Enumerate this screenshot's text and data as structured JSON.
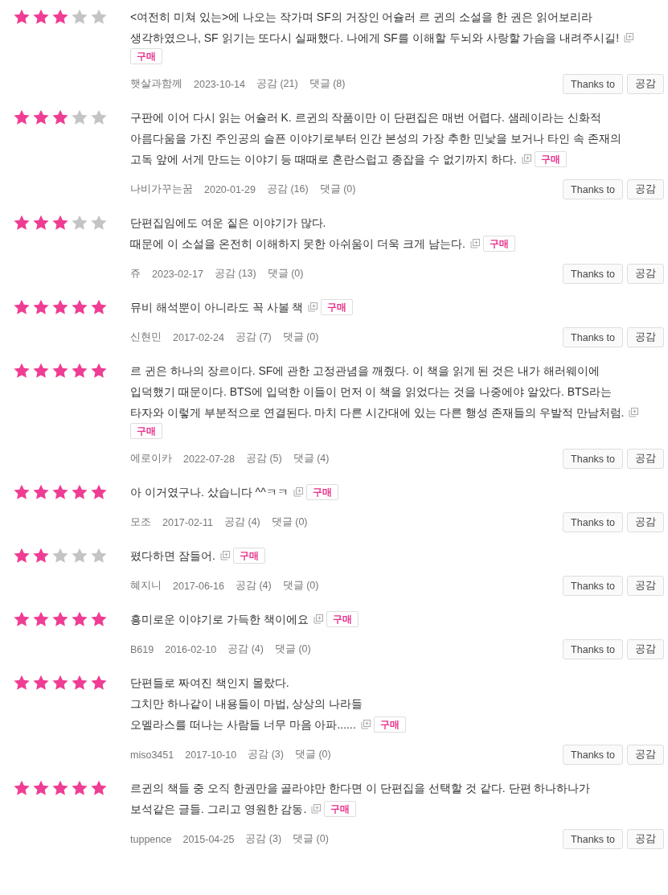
{
  "reviews": [
    {
      "stars": 3,
      "text": "<여전히 미쳐 있는>에 나오는 작가며 SF의 거장인 어슐러 르 귄의 소설을 한 권은 읽어보리라\n생각하였으나, SF 읽기는 또다시 실패했다. 나에게 SF를 이해할 두뇌와 사랑할 가슴을 내려주시길!",
      "badge": "구매",
      "author": "햇살과함께",
      "date": "2023-10-14",
      "likes": "공감 (21)",
      "comments": "댓글 (8)",
      "buttons": [
        "Thanks to",
        "공감"
      ]
    },
    {
      "stars": 3,
      "text": "구판에 이어 다시 읽는 어슐러 K. 르귄의 작품이만 이 단편집은 매번 어렵다. 샘레이라는 신화적\n아름다움을 가진 주인공의 슬픈 이야기로부터 인간 본성의 가장 추한 민낯을 보거나 타인 속 존재의\n고독 앞에 서게 만드는 이야기 등 때때로 혼란스럽고 종잡을 수 없기까지 하다.",
      "badge": "구매",
      "author": "나비가꾸는꿈",
      "date": "2020-01-29",
      "likes": "공감 (16)",
      "comments": "댓글 (0)",
      "buttons": [
        "Thanks to",
        "공감"
      ]
    },
    {
      "stars": 3,
      "text": "단편집임에도 여운 짙은 이야기가 많다.\n때문에 이 소설을 온전히 이해하지 못한 아쉬움이 더욱 크게 남는다.",
      "badge": "구매",
      "author": "쥬",
      "date": "2023-02-17",
      "likes": "공감 (13)",
      "comments": "댓글 (0)",
      "buttons": [
        "Thanks to",
        "공감"
      ]
    },
    {
      "stars": 5,
      "text": "뮤비 해석뿐이 아니라도 꼭 사볼 책",
      "badge": "구매",
      "author": "신현민",
      "date": "2017-02-24",
      "likes": "공감 (7)",
      "comments": "댓글 (0)",
      "buttons": [
        "Thanks to",
        "공감"
      ]
    },
    {
      "stars": 5,
      "text": "르 귄은 하나의 장르이다. SF에 관한 고정관념을 깨줬다. 이 책을 읽게 된 것은 내가 해러웨이에\n입덕했기 때문이다. BTS에 입덕한 이들이 먼저 이 책을 읽었다는 것을 나중에야 알았다. BTS라는\n타자와 이렇게 부분적으로 연결된다. 마치 다른 시간대에 있는 다른 행성 존재들의 우발적 만남처럼.",
      "badge": "구매",
      "author": "에로이카",
      "date": "2022-07-28",
      "likes": "공감 (5)",
      "comments": "댓글 (4)",
      "buttons": [
        "Thanks to",
        "공감"
      ]
    },
    {
      "stars": 5,
      "text": "아 이거였구나. 샀습니다 ^^ㅋㅋ",
      "badge": "구매",
      "author": "모조",
      "date": "2017-02-11",
      "likes": "공감 (4)",
      "comments": "댓글 (0)",
      "buttons": [
        "Thanks to",
        "공감"
      ]
    },
    {
      "stars": 2,
      "text": "폈다하면 잠들어.",
      "badge": "구매",
      "author": "혜지니",
      "date": "2017-06-16",
      "likes": "공감 (4)",
      "comments": "댓글 (0)",
      "buttons": [
        "Thanks to",
        "공감"
      ]
    },
    {
      "stars": 5,
      "text": "흥미로운 이야기로 가득한 책이에요",
      "badge": "구매",
      "author": "B619",
      "date": "2016-02-10",
      "likes": "공감 (4)",
      "comments": "댓글 (0)",
      "buttons": [
        "Thanks to",
        "공감"
      ]
    },
    {
      "stars": 5,
      "text": "단편들로 짜여진 책인지 몰랐다.\n그치만 하나같이 내용들이 마법, 상상의 나라들\n오멜라스를 떠나는 사람들 너무 마음 아파......",
      "badge": "구매",
      "author": "miso3451",
      "date": "2017-10-10",
      "likes": "공감 (3)",
      "comments": "댓글 (0)",
      "buttons": [
        "Thanks to",
        "공감"
      ]
    },
    {
      "stars": 5,
      "text": "르귄의 책들 중 오직 한권만을 골라야만 한다면 이 단편집을 선택할 것 같다. 단편 하나하나가\n보석같은 글들. 그리고 영원한 감동.",
      "badge": "구매",
      "author": "tuppence",
      "date": "2015-04-25",
      "likes": "공감 (3)",
      "comments": "댓글 (0)",
      "buttons": [
        "Thanks to",
        "공감"
      ]
    }
  ]
}
